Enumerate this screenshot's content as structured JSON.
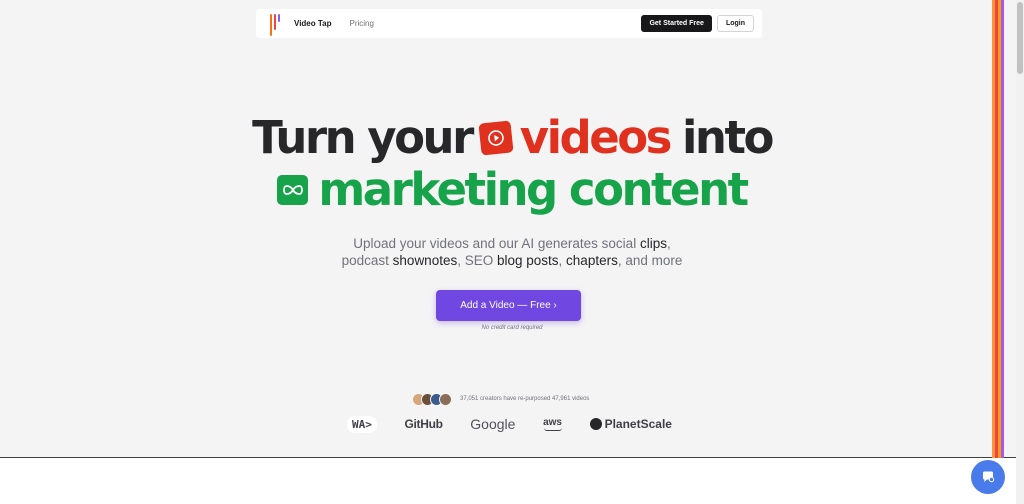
{
  "colors": {
    "accent": "#7047e0",
    "red": "#e0301e",
    "green": "#16a34a",
    "chat": "#4a7bea"
  },
  "header": {
    "brand": "Video Tap",
    "nav": [
      "Pricing"
    ],
    "get_started": "Get Started Free",
    "login": "Login"
  },
  "hero": {
    "line1_pre": "Turn your",
    "line1_highlight": "videos",
    "line1_post": "into",
    "line2": "marketing content",
    "icon1": "play-icon",
    "icon2": "infinity-icon"
  },
  "subtitle": {
    "p1": "Upload your videos and our AI generates social ",
    "k1": "clips",
    "p2": ",",
    "p3": "podcast ",
    "k2": "shownotes",
    "p4": ", SEO ",
    "k3": "blog posts",
    "p5": ", ",
    "k4": "chapters",
    "p6": ", and more"
  },
  "cta": {
    "label": "Add a Video — Free ›",
    "note": "No credit card required"
  },
  "proof": {
    "text": "37,051 creators have re-purposed 47,961 videos"
  },
  "logos": {
    "wa": "WA>",
    "github": "GitHub",
    "google": "Google",
    "aws": "aws",
    "planetscale": "PlanetScale"
  }
}
